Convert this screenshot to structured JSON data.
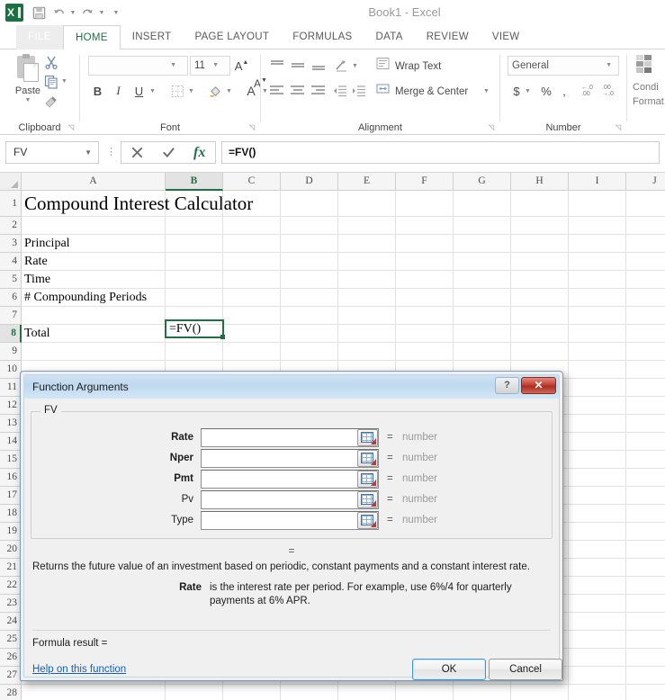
{
  "window": {
    "title": "Book1 - Excel"
  },
  "quick_access": {
    "items": [
      {
        "name": "excel-logo",
        "label": "X"
      },
      {
        "name": "save",
        "label": "Save"
      },
      {
        "name": "undo",
        "label": "Undo"
      },
      {
        "name": "redo",
        "label": "Redo"
      },
      {
        "name": "customize",
        "label": "Customize Quick Access Toolbar"
      }
    ]
  },
  "ribbon": {
    "file_tab": "FILE",
    "tabs": [
      {
        "label": "HOME",
        "active": true
      },
      {
        "label": "INSERT",
        "active": false
      },
      {
        "label": "PAGE LAYOUT",
        "active": false
      },
      {
        "label": "FORMULAS",
        "active": false
      },
      {
        "label": "DATA",
        "active": false
      },
      {
        "label": "REVIEW",
        "active": false
      },
      {
        "label": "VIEW",
        "active": false
      }
    ],
    "groups": {
      "clipboard": {
        "label": "Clipboard",
        "paste": "Paste",
        "cut": "Cut",
        "copy": "Copy",
        "format_painter": "Format Painter"
      },
      "font": {
        "label": "Font",
        "font_name": "",
        "font_size": "11",
        "grow": "A",
        "shrink": "A",
        "bold": "B",
        "italic": "I",
        "underline": "U",
        "font_color": "A"
      },
      "alignment": {
        "label": "Alignment",
        "wrap_text": "Wrap Text",
        "merge_center": "Merge & Center"
      },
      "number": {
        "label": "Number",
        "format": "General",
        "currency": "$",
        "percent": "%",
        "comma": ",",
        "increase_decimal": ".00",
        "decrease_decimal": ".00"
      },
      "styles": {
        "conditional_formatting_line1": "Condi",
        "conditional_formatting_line2": "Format"
      }
    }
  },
  "formula_bar": {
    "name_box": "FV",
    "cancel": "✕",
    "enter": "✓",
    "insert_function": "fx",
    "formula": "=FV()"
  },
  "grid": {
    "columns": [
      "A",
      "B",
      "C",
      "D",
      "E",
      "F",
      "G",
      "H",
      "I",
      "J"
    ],
    "selected_column": "B",
    "selected_row": 8,
    "rows": [
      {
        "num": "1",
        "a": "Compound Interest Calculator"
      },
      {
        "num": "2",
        "a": ""
      },
      {
        "num": "3",
        "a": "Principal"
      },
      {
        "num": "4",
        "a": "Rate"
      },
      {
        "num": "5",
        "a": "Time"
      },
      {
        "num": "6",
        "a": "# Compounding Periods"
      },
      {
        "num": "7",
        "a": ""
      },
      {
        "num": "8",
        "a": "Total"
      },
      {
        "num": "9",
        "a": ""
      },
      {
        "num": "10",
        "a": ""
      },
      {
        "num": "11",
        "a": ""
      },
      {
        "num": "12",
        "a": ""
      },
      {
        "num": "13",
        "a": ""
      },
      {
        "num": "14",
        "a": ""
      },
      {
        "num": "15",
        "a": ""
      },
      {
        "num": "16",
        "a": ""
      },
      {
        "num": "17",
        "a": ""
      },
      {
        "num": "18",
        "a": ""
      },
      {
        "num": "19",
        "a": ""
      },
      {
        "num": "20",
        "a": ""
      },
      {
        "num": "21",
        "a": ""
      },
      {
        "num": "22",
        "a": ""
      },
      {
        "num": "23",
        "a": ""
      },
      {
        "num": "24",
        "a": ""
      },
      {
        "num": "25",
        "a": ""
      },
      {
        "num": "26",
        "a": ""
      },
      {
        "num": "27",
        "a": ""
      },
      {
        "num": "28",
        "a": ""
      }
    ],
    "active_cell_value": "=FV()"
  },
  "dialog": {
    "title": "Function Arguments",
    "help_button": "?",
    "close_button": "✕",
    "function_name": "FV",
    "arguments": [
      {
        "label": "Rate",
        "required": true,
        "value": "",
        "equals": "=",
        "result": "number"
      },
      {
        "label": "Nper",
        "required": true,
        "value": "",
        "equals": "=",
        "result": "number"
      },
      {
        "label": "Pmt",
        "required": true,
        "value": "",
        "equals": "=",
        "result": "number"
      },
      {
        "label": "Pv",
        "required": false,
        "value": "",
        "equals": "=",
        "result": "number"
      },
      {
        "label": "Type",
        "required": false,
        "value": "",
        "equals": "=",
        "result": "number"
      }
    ],
    "overall_equals": "=",
    "description": "Returns the future value of an investment based on periodic, constant payments and a constant interest rate.",
    "argument_help_label": "Rate",
    "argument_help_text": "is the interest rate per period. For example, use 6%/4 for quarterly payments at 6% APR.",
    "formula_result_label": "Formula result =",
    "formula_result_value": "",
    "help_link": "Help on this function",
    "ok_button": "OK",
    "cancel_button": "Cancel"
  }
}
